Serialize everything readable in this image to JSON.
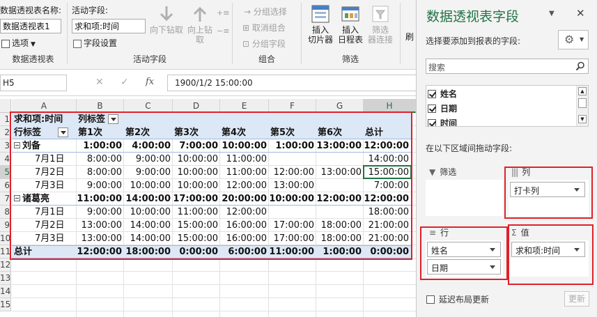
{
  "ribbon": {
    "pivot_name_label": "数据透视表名称:",
    "pivot_name_value": "数据透视表1",
    "options_label": "选项",
    "group_pivot_label": "数据透视表",
    "active_field_label": "活动字段:",
    "active_field_value": "求和项:时间",
    "field_settings_label": "字段设置",
    "drill_down_label": "向下钻取",
    "drill_up_label_1": "向上钻",
    "drill_up_label_2": "取",
    "group_active_label": "活动字段",
    "group_selection_label": "分组选择",
    "ungroup_label": "取消组合",
    "group_field_label": "分组字段",
    "group_group_label": "组合",
    "insert_slicer_label_1": "插入",
    "insert_slicer_label_2": "切片器",
    "insert_timeline_label_1": "插入",
    "insert_timeline_label_2": "日程表",
    "filter_conn_label_1": "筛选",
    "filter_conn_label_2": "器连接",
    "group_filter_label": "筛选",
    "truncated_label": "刷"
  },
  "formula_bar": {
    "name_box": "H5",
    "fx": "fx",
    "formula": "1900/1/2  15:00:00"
  },
  "grid": {
    "columns": [
      "A",
      "B",
      "C",
      "D",
      "E",
      "F",
      "G",
      "H"
    ],
    "rows": [
      "1",
      "2",
      "3",
      "4",
      "5",
      "6",
      "7",
      "8",
      "9",
      "10",
      "11",
      "12",
      "13",
      "14",
      "15"
    ],
    "row_labels_display": [
      "1",
      "2",
      "3",
      "4",
      "5",
      "6",
      "7",
      "8",
      "9",
      "10",
      "11",
      "12",
      "13",
      "14",
      "15"
    ]
  },
  "pivot": {
    "values_label": "求和项:时间",
    "col_labels_label": "列标签",
    "row_labels_label": "行标签",
    "headers": [
      "第1次",
      "第2次",
      "第3次",
      "第4次",
      "第5次",
      "第6次",
      "总计"
    ],
    "groups": [
      {
        "name": "刘备",
        "subtotal": [
          "1:00:00",
          "4:00:00",
          "7:00:00",
          "10:00:00",
          "1:00:00",
          "13:00:00",
          "12:00:00"
        ],
        "rows": [
          {
            "label": "7月1日",
            "values": [
              "8:00:00",
              "9:00:00",
              "10:00:00",
              "11:00:00",
              "",
              "",
              "14:00:00"
            ]
          },
          {
            "label": "7月2日",
            "values": [
              "8:00:00",
              "9:00:00",
              "10:00:00",
              "11:00:00",
              "12:00:00",
              "13:00:00",
              "15:00:00"
            ]
          },
          {
            "label": "7月3日",
            "values": [
              "9:00:00",
              "10:00:00",
              "10:00:00",
              "12:00:00",
              "13:00:00",
              "",
              "7:00:00"
            ]
          }
        ]
      },
      {
        "name": "诸葛亮",
        "subtotal": [
          "11:00:00",
          "14:00:00",
          "17:00:00",
          "20:00:00",
          "10:00:00",
          "12:00:00",
          "12:00:00"
        ],
        "rows": [
          {
            "label": "7月1日",
            "values": [
              "9:00:00",
              "10:00:00",
              "11:00:00",
              "12:00:00",
              "",
              "",
              "18:00:00"
            ]
          },
          {
            "label": "7月2日",
            "values": [
              "13:00:00",
              "14:00:00",
              "15:00:00",
              "16:00:00",
              "17:00:00",
              "18:00:00",
              "21:00:00"
            ]
          },
          {
            "label": "7月3日",
            "values": [
              "13:00:00",
              "14:00:00",
              "15:00:00",
              "16:00:00",
              "17:00:00",
              "18:00:00",
              "21:00:00"
            ]
          }
        ]
      }
    ],
    "total_label": "总计",
    "grand_total": [
      "12:00:00",
      "18:00:00",
      "0:00:00",
      "6:00:00",
      "11:00:00",
      "1:00:00",
      "0:00:00"
    ]
  },
  "pane": {
    "title": "数据透视表字段",
    "choose_label": "选择要添加到报表的字段:",
    "search_placeholder": "搜索",
    "fields": [
      {
        "name": "姓名",
        "checked": true
      },
      {
        "name": "日期",
        "checked": true
      },
      {
        "name": "时间",
        "checked": true
      }
    ],
    "drag_label": "在以下区域间拖动字段:",
    "filters_label": "筛选",
    "columns_label": "列",
    "columns_items": [
      "打卡列"
    ],
    "rows_label": "行",
    "rows_items": [
      "姓名",
      "日期"
    ],
    "values_label": "值",
    "values_items": [
      "求和项:时间"
    ],
    "defer_label": "延迟布局更新",
    "update_label": "更新"
  },
  "colors": {
    "accent_green": "#217346",
    "highlight_red": "#e0202a",
    "pivot_band": "#dde8f6"
  }
}
